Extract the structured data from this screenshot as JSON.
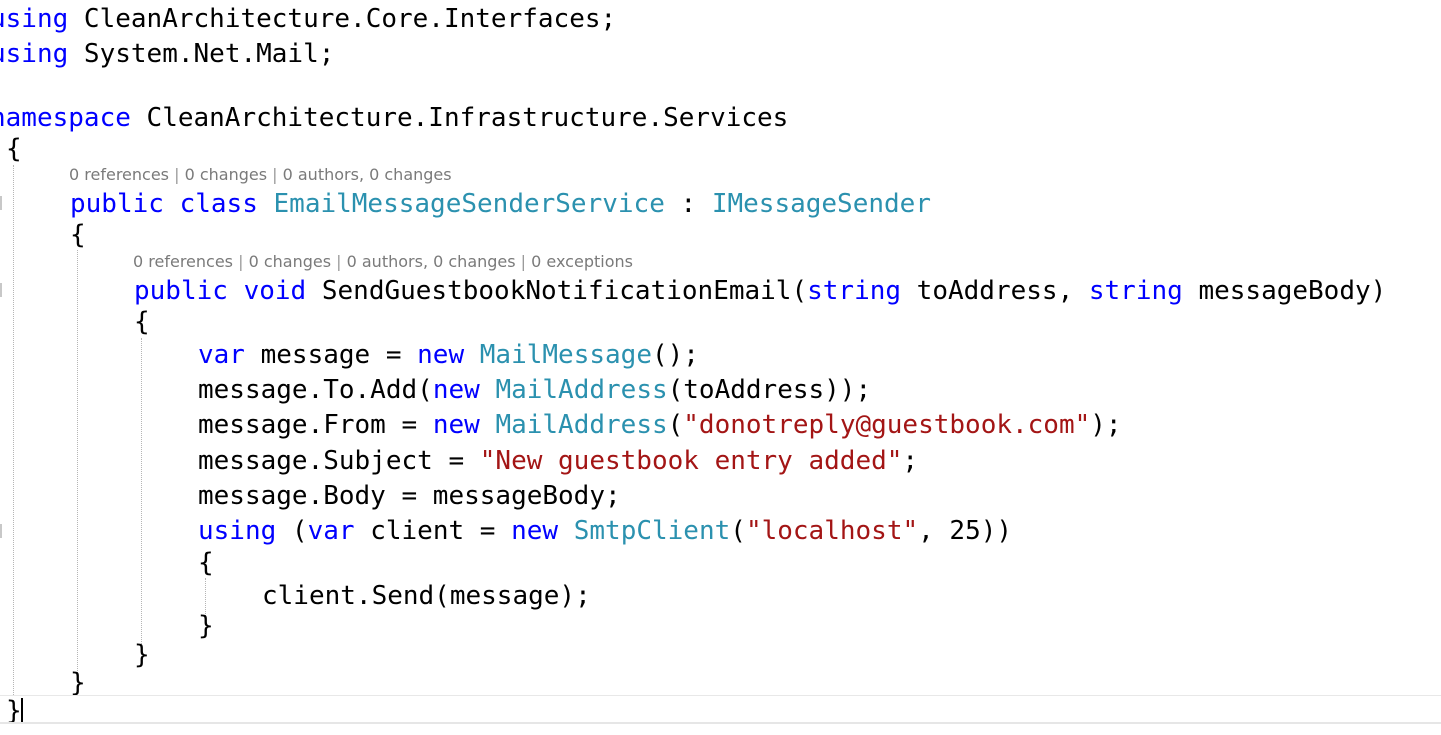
{
  "code": {
    "l1": {
      "kw": "using",
      "rest": " CleanArchitecture.Core.Interfaces;"
    },
    "l2": {
      "kw": "using",
      "rest": " System.Net.Mail;"
    },
    "l3": {
      "kw": "namespace",
      "rest": " CleanArchitecture.Infrastructure.Services"
    },
    "l4": {
      "text": "{"
    },
    "lens1": {
      "refs": "0 references",
      "changes": "0 changes",
      "authors": "0 authors, 0 changes"
    },
    "l5": {
      "kw1": "public",
      "kw2": "class",
      "type1": "EmailMessageSenderService",
      "colon": " : ",
      "type2": "IMessageSender"
    },
    "l6": {
      "text": "{"
    },
    "lens2": {
      "refs": "0 references",
      "changes": "0 changes",
      "authors": "0 authors, 0 changes",
      "exceptions": "0 exceptions"
    },
    "l7": {
      "kw1": "public",
      "kw2": "void",
      "name": " SendGuestbookNotificationEmail(",
      "kw3": "string",
      "p1": " toAddress, ",
      "kw4": "string",
      "p2": " messageBody)"
    },
    "l8": {
      "text": "{"
    },
    "l9": {
      "kw1": "var",
      "a": " message = ",
      "kw2": "new",
      "type": "MailMessage",
      "b": "();"
    },
    "l10": {
      "a": "message.To.Add(",
      "kw": "new",
      "type": "MailAddress",
      "b": "(toAddress));"
    },
    "l11": {
      "a": "message.From = ",
      "kw": "new",
      "type": "MailAddress",
      "b": "(",
      "str": "\"donotreply@guestbook.com\"",
      "c": ");"
    },
    "l12": {
      "a": "message.Subject = ",
      "str": "\"New guestbook entry added\"",
      "b": ";"
    },
    "l13": {
      "a": "message.Body = messageBody;"
    },
    "l14": {
      "kw1": "using",
      "a": " (",
      "kw2": "var",
      "b": " client = ",
      "kw3": "new",
      "type": "SmtpClient",
      "c": "(",
      "str": "\"localhost\"",
      "d": ", 25))"
    },
    "l15": {
      "text": "{"
    },
    "l16": {
      "a": "client.Send(message);"
    },
    "l17": {
      "text": "}"
    },
    "l18": {
      "text": "}"
    },
    "l19": {
      "text": "}"
    },
    "l20": {
      "text": "}"
    }
  },
  "colors": {
    "keyword": "#0000ff",
    "type": "#2b91af",
    "string": "#a31515",
    "codelens": "#7a7a7a"
  }
}
